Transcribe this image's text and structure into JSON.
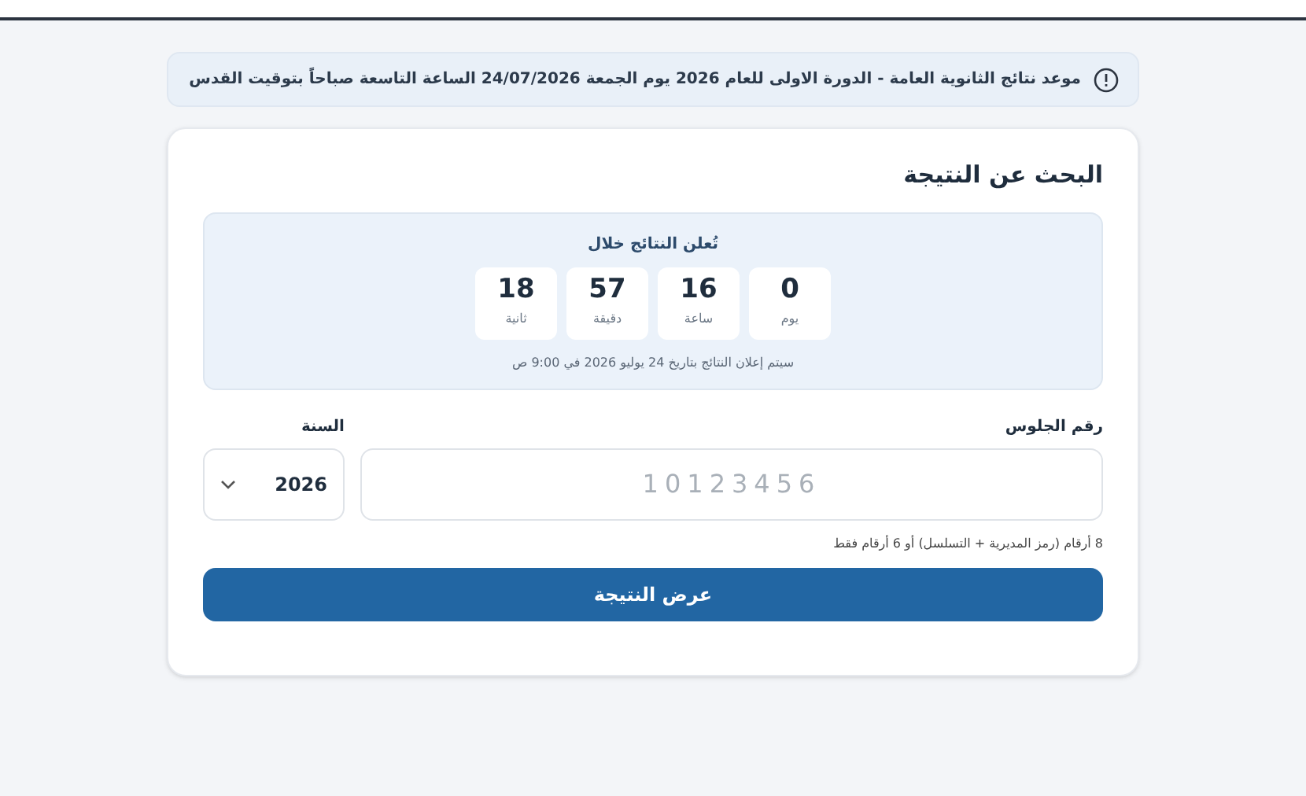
{
  "notice": {
    "text": "موعد نتائج الثانوية العامة - الدورة الاولى للعام 2026 يوم الجمعة 24/07/2026 الساعة التاسعة صباحاً بتوقيت القدس"
  },
  "card": {
    "title": "البحث عن النتيجة",
    "countdown": {
      "heading": "تُعلن النتائج خلال",
      "units": [
        {
          "value": "0",
          "label": "يوم"
        },
        {
          "value": "16",
          "label": "ساعة"
        },
        {
          "value": "57",
          "label": "دقيقة"
        },
        {
          "value": "18",
          "label": "ثانية"
        }
      ],
      "note": "سيتم إعلان النتائج بتاريخ 24 يوليو 2026 في 9:00 ص"
    },
    "seat_field": {
      "label": "رقم الجلوس",
      "placeholder": "10123456"
    },
    "year_field": {
      "label": "السنة",
      "value": "2026"
    },
    "hint": "8 أرقام (رمز المديرية + التسلسل) أو 6 أرقام فقط",
    "submit": "عرض النتيجة"
  }
}
